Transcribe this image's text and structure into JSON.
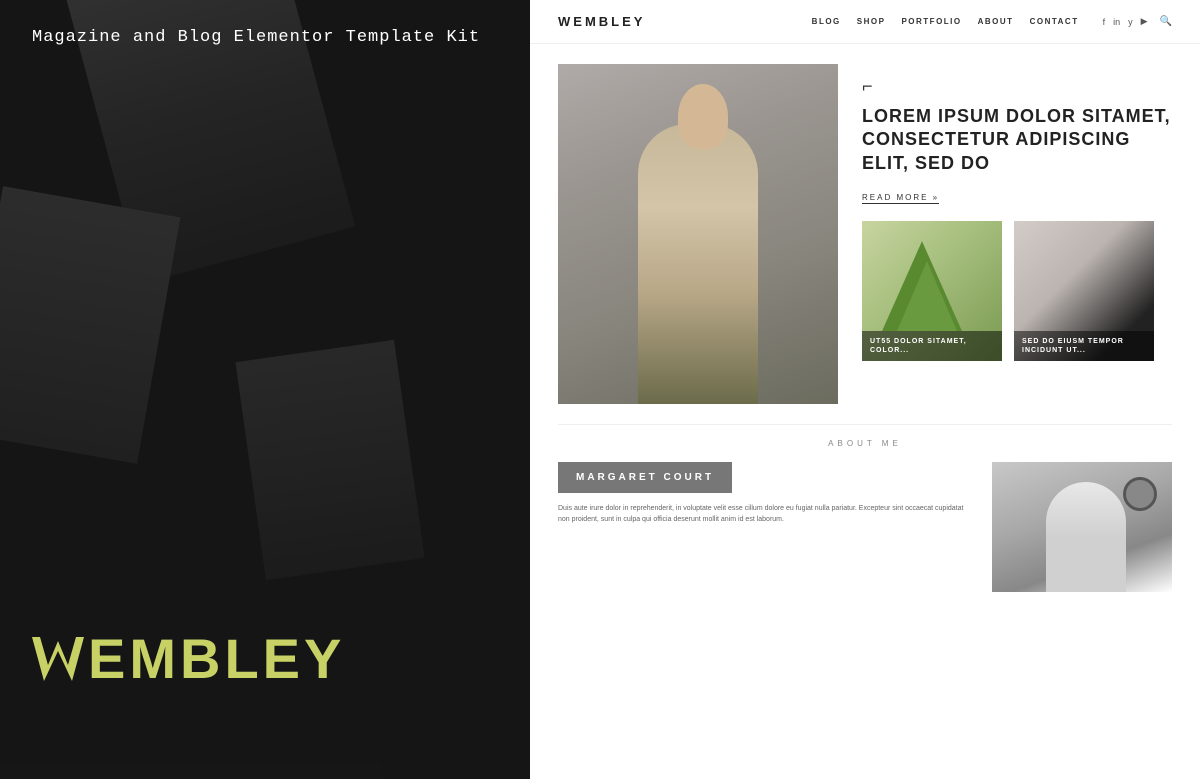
{
  "left_panel": {
    "kit_title": "Magazine and Blog Elementor Template Kit",
    "logo_text": "EMBLEY",
    "logo_w": "W"
  },
  "right_panel": {
    "header": {
      "logo": "WEMBLEY",
      "nav": [
        {
          "label": "BLOG"
        },
        {
          "label": "SHOP"
        },
        {
          "label": "PORTFOLIO"
        },
        {
          "label": "ABOUT"
        },
        {
          "label": "CONTACT"
        }
      ],
      "social": [
        "f",
        "in",
        "y",
        "▶"
      ],
      "search_icon": "🔍"
    },
    "hero": {
      "headline": "LOREM IPSUM DOLOR SITAMET, CONSECTETUR ADIPISCING ELIT, SED DO",
      "read_more": "READ MORE »",
      "bracket_top": "⌐",
      "bracket_bottom": "¬"
    },
    "small_cards": [
      {
        "text": "UT55 DOLOR SITAMET, COLOR..."
      },
      {
        "text": "SED DO EIUSM TEMPOR INCIDUNT UT..."
      }
    ],
    "about": {
      "section_label": "ABOUT ME",
      "name_badge": "MARGARET COURT",
      "bio": "Duis aute irure dolor in reprehenderit, in voluptate velit esse cillum dolore eu fugiat nulla pariatur. Excepteur sint occaecat cupidatat non proident, sunt in culpa qui officia deserunt mollit anim id est laborum."
    }
  }
}
